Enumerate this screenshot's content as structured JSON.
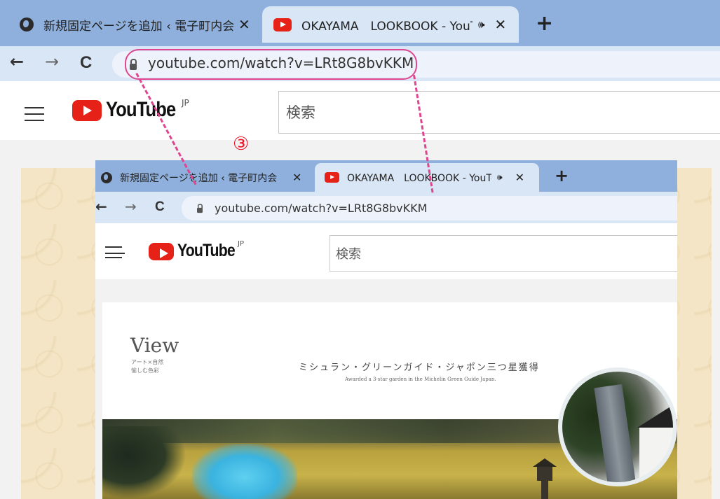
{
  "outer_browser": {
    "tabs": [
      {
        "title": "新規固定ページを追加 ‹ 電子町内会",
        "close": "✕",
        "active": false
      },
      {
        "title": "OKAYAMA　LOOKBOOK - YouTube",
        "close": "✕",
        "audio": "🕪",
        "active": true
      }
    ],
    "new_tab": "+",
    "nav": {
      "back": "←",
      "forward": "→",
      "reload": "C"
    },
    "url": "youtube.com/watch?v=LRt8G8bvKKM"
  },
  "youtube": {
    "logo_text": "YouTube",
    "region": "JP",
    "search_placeholder": "検索"
  },
  "annotation": {
    "step_number": "③",
    "highlight_color": "#e0468f",
    "number_color": "#e8152a"
  },
  "inner_screenshot": {
    "tabs": [
      {
        "title": "新規固定ページを追加 ‹ 電子町内会",
        "close": "✕"
      },
      {
        "title": "OKAYAMA　LOOKBOOK - YouTube",
        "close": "✕",
        "audio": "🕪"
      }
    ],
    "new_tab": "+",
    "nav": {
      "back": "←",
      "forward": "→",
      "reload": "C"
    },
    "url": "youtube.com/watch?v=LRt8G8bvKKM",
    "logo_text": "YouTube",
    "region": "JP",
    "search_placeholder": "検索",
    "video": {
      "view_title": "View",
      "view_sub_line1": "アート×自然",
      "view_sub_line2": "愉しむ色彩",
      "headline_jp": "ミシュラン・グリーンガイド・ジャポン三つ星獲得",
      "headline_en": "Awarded a 3-star garden in the Michelin Green Guide Japan."
    }
  },
  "colors": {
    "tabstrip": "#8fb0dc",
    "toolbar": "#d9e6f6",
    "youtube_red": "#e62117"
  }
}
